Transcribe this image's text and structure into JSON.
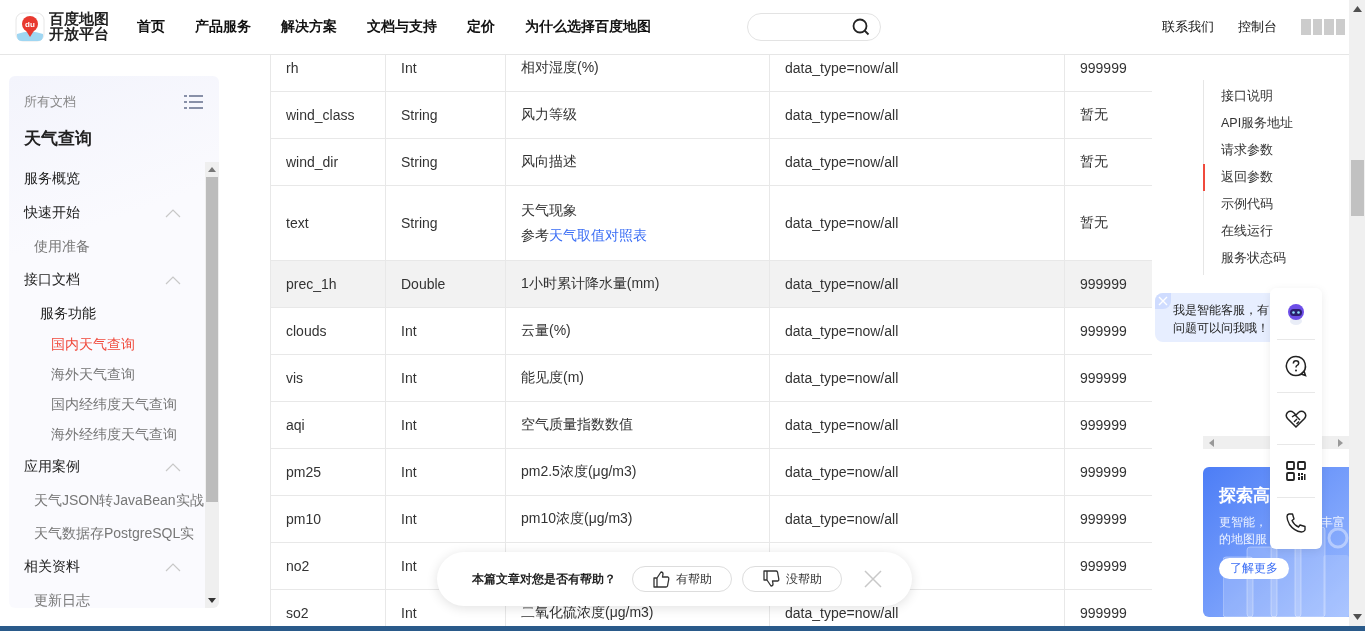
{
  "header": {
    "logo": {
      "badge": "du",
      "line1": "百度地图",
      "line2": "开放平台"
    },
    "nav": [
      "首页",
      "产品服务",
      "解决方案",
      "文档与支持",
      "定价",
      "为什么选择百度地图"
    ],
    "links": [
      "联系我们",
      "控制台"
    ]
  },
  "sidebar": {
    "all_docs": "所有文档",
    "title": "天气查询",
    "items": [
      {
        "label": "服务概览",
        "selected": false
      },
      {
        "label": "快速开始",
        "selected": false,
        "expanded": true,
        "children": [
          {
            "label": "使用准备",
            "selected": false
          }
        ]
      },
      {
        "label": "接口文档",
        "selected": false,
        "expanded": true,
        "children": [
          {
            "label": "服务功能",
            "selected": false,
            "children": [
              {
                "label": "国内天气查询",
                "selected": true
              },
              {
                "label": "海外天气查询",
                "selected": false
              },
              {
                "label": "国内经纬度天气查询",
                "selected": false
              },
              {
                "label": "海外经纬度天气查询",
                "selected": false
              }
            ]
          }
        ]
      },
      {
        "label": "应用案例",
        "selected": false,
        "expanded": true,
        "children": [
          {
            "label": "天气JSON转JavaBean实战",
            "selected": false
          },
          {
            "label": "天气数据存PostgreSQL实",
            "selected": false
          }
        ]
      },
      {
        "label": "相关资料",
        "selected": false,
        "expanded": true,
        "children": [
          {
            "label": "更新日志",
            "selected": false
          }
        ]
      }
    ]
  },
  "table": {
    "rows": [
      {
        "name": "rh",
        "type": "Int",
        "description": "相对湿度(%)",
        "scope": "data_type=now/all",
        "default": "999999",
        "highlighted": false
      },
      {
        "name": "wind_class",
        "type": "String",
        "description": "风力等级",
        "scope": "data_type=now/all",
        "default": "暂无",
        "highlighted": false
      },
      {
        "name": "wind_dir",
        "type": "String",
        "description": "风向描述",
        "scope": "data_type=now/all",
        "default": "暂无",
        "highlighted": false
      },
      {
        "name": "text",
        "type": "String",
        "description": "天气现象",
        "note": "参考",
        "link": "天气取值对照表",
        "scope": "data_type=now/all",
        "default": "暂无",
        "highlighted": false
      },
      {
        "name": "prec_1h",
        "type": "Double",
        "description": "1小时累计降水量(mm)",
        "scope": "data_type=now/all",
        "default": "999999",
        "highlighted": true
      },
      {
        "name": "clouds",
        "type": "Int",
        "description": "云量(%)",
        "scope": "data_type=now/all",
        "default": "999999",
        "highlighted": false
      },
      {
        "name": "vis",
        "type": "Int",
        "description": "能见度(m)",
        "scope": "data_type=now/all",
        "default": "999999",
        "highlighted": false
      },
      {
        "name": "aqi",
        "type": "Int",
        "description": "空气质量指数数值",
        "scope": "data_type=now/all",
        "default": "999999",
        "highlighted": false
      },
      {
        "name": "pm25",
        "type": "Int",
        "description": "pm2.5浓度(μg/m3)",
        "scope": "data_type=now/all",
        "default": "999999",
        "highlighted": false
      },
      {
        "name": "pm10",
        "type": "Int",
        "description": "pm10浓度(μg/m3)",
        "scope": "data_type=now/all",
        "default": "999999",
        "highlighted": false
      },
      {
        "name": "no2",
        "type": "Int",
        "default": "999999",
        "highlighted": false
      },
      {
        "name": "so2",
        "type": "Int",
        "description": "二氧化硫浓度(μg/m3)",
        "scope": "data_type=now/all",
        "default": "999999",
        "highlighted": false
      }
    ]
  },
  "toc": {
    "items": [
      {
        "label": "接口说明",
        "selected": false
      },
      {
        "label": "API服务地址",
        "selected": false
      },
      {
        "label": "请求参数",
        "selected": false
      },
      {
        "label": "返回参数",
        "selected": true
      },
      {
        "label": "示例代码",
        "selected": false
      },
      {
        "label": "在线运行",
        "selected": false
      },
      {
        "label": "服务状态码",
        "selected": false
      }
    ]
  },
  "banner": {
    "title": "探索高",
    "line1_start": "更智能，",
    "line1_end": "丰富",
    "line2": "的地图服",
    "button": "了解更多"
  },
  "chat_bubble": {
    "text": "我是智能客服，有问题可以问我哦！"
  },
  "toolbar": {
    "items": [
      {
        "kind": "robot"
      },
      {
        "kind": "help"
      },
      {
        "kind": "handshake"
      },
      {
        "kind": "qrcode"
      },
      {
        "kind": "phone"
      }
    ]
  },
  "feedback": {
    "question": "本篇文章对您是否有帮助？",
    "buttons": [
      {
        "kind": "up",
        "label": "有帮助"
      },
      {
        "kind": "down",
        "label": "没帮助"
      }
    ]
  }
}
